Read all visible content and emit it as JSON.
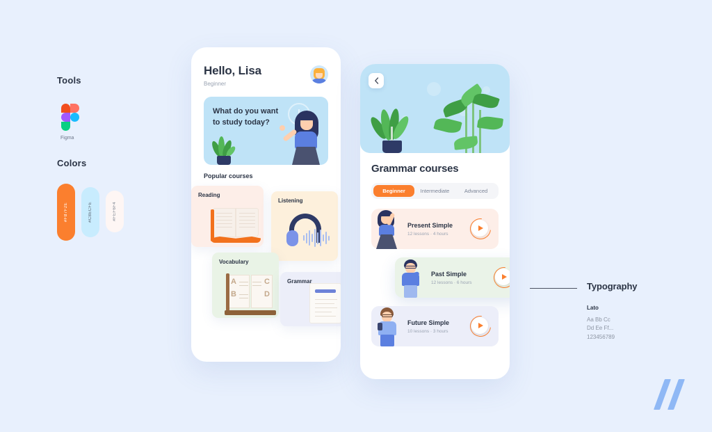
{
  "background_color": "#E8F0FD",
  "spec": {
    "tools": {
      "heading": "Tools",
      "items": [
        {
          "icon": "figma-icon",
          "label": "Figma"
        }
      ]
    },
    "colors": {
      "heading": "Colors",
      "swatches": [
        {
          "hex": "#FB7F2E",
          "label": "#FB7F2E"
        },
        {
          "hex": "#C8ECFE",
          "label": "#C8ECFE"
        },
        {
          "hex": "#FEF6F4",
          "label": "#FEF6F4"
        }
      ]
    },
    "typography": {
      "heading": "Typography",
      "font_name": "Lato",
      "alphabet_sample": "Aa Bb Cc Dd Ee Ff...",
      "numeral_sample": "123456789"
    }
  },
  "phone_home": {
    "greeting": "Hello, Lisa",
    "level": "Beginner",
    "avatar": "user-avatar",
    "banner": {
      "line1": "What do you want",
      "line2": "to study today?",
      "watermark_icon": "clock-icon"
    },
    "section_label": "Popular courses",
    "courses": [
      {
        "label": "Reading",
        "icon": "open-book-icon",
        "color": "#FDEEE8"
      },
      {
        "label": "Listening",
        "icon": "headphones-icon",
        "color": "#FDF0DC"
      },
      {
        "label": "Vocabulary",
        "icon": "dictionary-book-icon",
        "color": "#E9F3E6"
      },
      {
        "label": "Grammar",
        "icon": "document-icon",
        "color": "#ECEEF9"
      }
    ]
  },
  "phone_courses": {
    "back_button": "chevron-left-icon",
    "hero_illustration": "plants-illustration",
    "title": "Grammar courses",
    "tabs": [
      {
        "label": "Beginner",
        "active": true
      },
      {
        "label": "Intermediate",
        "active": false
      },
      {
        "label": "Advanced",
        "active": false
      }
    ],
    "lessons": [
      {
        "title": "Present Simple",
        "meta": "12 lessons · 4 hours",
        "color": "#FDEEE8",
        "action": "play-button"
      },
      {
        "title": "Past Simple",
        "meta": "12 lessons · 6 hours",
        "color": "#EAF3E8",
        "action": "play-button"
      },
      {
        "title": "Future Simple",
        "meta": "10 lessons · 3 hours",
        "color": "#ECEEF9",
        "action": "play-button"
      }
    ]
  },
  "brand_logo": "double-slash-logo"
}
